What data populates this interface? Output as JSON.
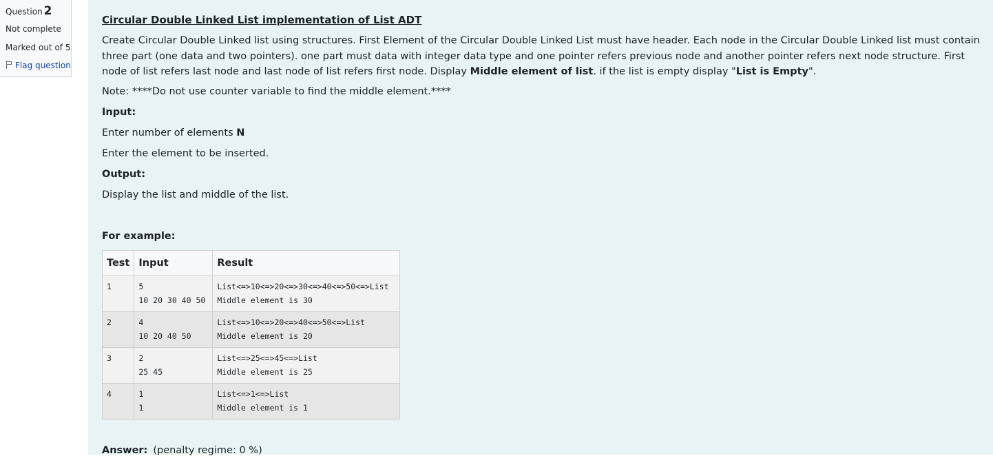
{
  "info": {
    "question_word": "Question",
    "question_number": "2",
    "state": "Not complete",
    "grade": "Marked out of 5",
    "flag_label": "Flag question"
  },
  "question": {
    "title": "Circular Double Linked List implementation of List ADT",
    "desc_part1": "Create Circular Double Linked list using structures. First Element of the Circular Double Linked List must have header. Each node in the Circular Double Linked list must contain three part (one data and two pointers). one part must data with integer data type and one pointer refers previous node and another pointer refers next node structure. First node of list refers last node and last node of list refers first node. Display ",
    "desc_bold1": "Middle element of list",
    "desc_part2": ". if the list is empty display \"",
    "desc_bold2": "List is Empty",
    "desc_part3": "\".",
    "note": "Note: ****Do not use counter variable to find the middle element.****",
    "input_heading": "Input:",
    "input_line1_text": "Enter number of elements ",
    "input_line1_bold": "N",
    "input_line2": "Enter the element to be inserted.",
    "output_heading": "Output:",
    "output_line": "Display the list and middle of the list.",
    "example_heading": "For example:"
  },
  "examples": {
    "headers": [
      "Test",
      "Input",
      "Result"
    ],
    "rows": [
      {
        "test": "1",
        "input": "5\n10 20 30 40 50",
        "result": "List<=>10<=>20<=>30<=>40<=>50<=>List\nMiddle element is 30"
      },
      {
        "test": "2",
        "input": "4\n10 20 40 50",
        "result": "List<=>10<=>20<=>40<=>50<=>List\nMiddle element is 20"
      },
      {
        "test": "3",
        "input": "2\n25 45",
        "result": "List<=>25<=>45<=>List\nMiddle element is 25"
      },
      {
        "test": "4",
        "input": "1\n1",
        "result": "List<=>1<=>List\nMiddle element is 1"
      }
    ]
  },
  "answer": {
    "label": "Answer:",
    "penalty": "(penalty regime: 0 %)"
  }
}
